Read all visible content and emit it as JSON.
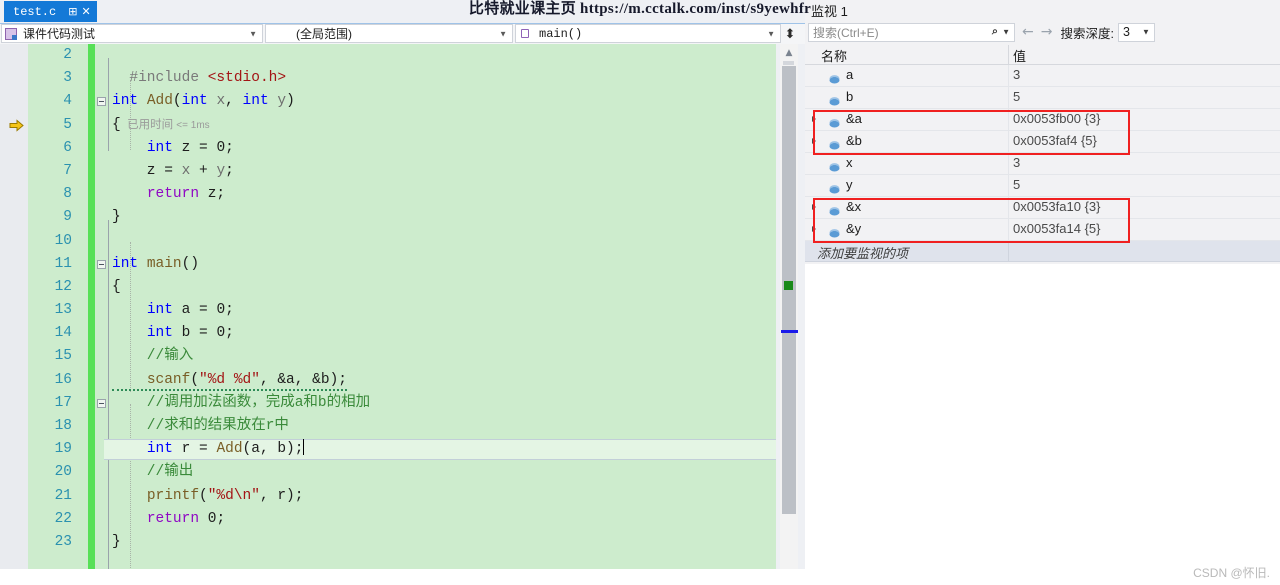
{
  "watermarks": {
    "top": "比特就业课主页  https://m.cctalk.com/inst/s9yewhfr",
    "bottom": "CSDN @怀旧."
  },
  "editor": {
    "tab": {
      "label": "test.c",
      "pin_icon": "pin-icon",
      "close_icon": "close-icon"
    },
    "navbar": {
      "project": "课件代码测试",
      "scope": "(全局范围)",
      "function": "main()",
      "split_icon": "split-view-icon"
    },
    "current_line": 19,
    "exec_pointer_line": 5,
    "inline_diagnostic": {
      "line": 5,
      "text": "已用时间",
      "suffix": "<= 1ms"
    },
    "lines": [
      {
        "n": "2",
        "tokens": []
      },
      {
        "n": "3",
        "tokens": [
          {
            "t": "  ",
            "c": "ident"
          },
          {
            "t": "#include ",
            "c": "pp"
          },
          {
            "t": "<stdio.h>",
            "c": "hdr"
          }
        ]
      },
      {
        "n": "4",
        "collapse": true,
        "tokens": [
          {
            "t": "int",
            "c": "kw"
          },
          {
            "t": " ",
            "c": "ident"
          },
          {
            "t": "Add",
            "c": "fn"
          },
          {
            "t": "(",
            "c": "ident"
          },
          {
            "t": "int",
            "c": "kw"
          },
          {
            "t": " ",
            "c": "ident"
          },
          {
            "t": "x",
            "c": "gray"
          },
          {
            "t": ", ",
            "c": "ident"
          },
          {
            "t": "int",
            "c": "kw"
          },
          {
            "t": " ",
            "c": "ident"
          },
          {
            "t": "y",
            "c": "gray"
          },
          {
            "t": ")",
            "c": "ident"
          }
        ]
      },
      {
        "n": "5",
        "tokens": [
          {
            "t": "{",
            "c": "ident"
          }
        ]
      },
      {
        "n": "6",
        "tokens": [
          {
            "t": "    ",
            "c": "ident"
          },
          {
            "t": "int",
            "c": "kw"
          },
          {
            "t": " z = ",
            "c": "ident"
          },
          {
            "t": "0",
            "c": "ident"
          },
          {
            "t": ";",
            "c": "ident"
          }
        ]
      },
      {
        "n": "7",
        "tokens": [
          {
            "t": "    z = ",
            "c": "ident"
          },
          {
            "t": "x",
            "c": "gray"
          },
          {
            "t": " + ",
            "c": "ident"
          },
          {
            "t": "y",
            "c": "gray"
          },
          {
            "t": ";",
            "c": "ident"
          }
        ]
      },
      {
        "n": "8",
        "tokens": [
          {
            "t": "    ",
            "c": "ident"
          },
          {
            "t": "return",
            "c": "kw2"
          },
          {
            "t": " z;",
            "c": "ident"
          }
        ]
      },
      {
        "n": "9",
        "tokens": [
          {
            "t": "}",
            "c": "ident"
          }
        ]
      },
      {
        "n": "10",
        "tokens": []
      },
      {
        "n": "11",
        "collapse": true,
        "tokens": [
          {
            "t": "int",
            "c": "kw"
          },
          {
            "t": " ",
            "c": "ident"
          },
          {
            "t": "main",
            "c": "fn"
          },
          {
            "t": "()",
            "c": "ident"
          }
        ]
      },
      {
        "n": "12",
        "tokens": [
          {
            "t": "{",
            "c": "ident"
          }
        ]
      },
      {
        "n": "13",
        "tokens": [
          {
            "t": "    ",
            "c": "ident"
          },
          {
            "t": "int",
            "c": "kw"
          },
          {
            "t": " a = ",
            "c": "ident"
          },
          {
            "t": "0",
            "c": "ident"
          },
          {
            "t": ";",
            "c": "ident"
          }
        ]
      },
      {
        "n": "14",
        "tokens": [
          {
            "t": "    ",
            "c": "ident"
          },
          {
            "t": "int",
            "c": "kw"
          },
          {
            "t": " b = ",
            "c": "ident"
          },
          {
            "t": "0",
            "c": "ident"
          },
          {
            "t": ";",
            "c": "ident"
          }
        ]
      },
      {
        "n": "15",
        "tokens": [
          {
            "t": "    //输入",
            "c": "cmt"
          }
        ]
      },
      {
        "n": "16",
        "squiggle": true,
        "tokens": [
          {
            "t": "    ",
            "c": "ident"
          },
          {
            "t": "scanf",
            "c": "fn"
          },
          {
            "t": "(",
            "c": "ident"
          },
          {
            "t": "\"%d %d\"",
            "c": "str"
          },
          {
            "t": ", &a, &b);",
            "c": "ident"
          }
        ]
      },
      {
        "n": "17",
        "collapse": true,
        "tokens": [
          {
            "t": "    //调用加法函数，完成a和b的相加",
            "c": "cmt"
          }
        ]
      },
      {
        "n": "18",
        "tokens": [
          {
            "t": "    //求和的结果放在r中",
            "c": "cmt"
          }
        ]
      },
      {
        "n": "19",
        "caret": true,
        "tokens": [
          {
            "t": "    ",
            "c": "ident"
          },
          {
            "t": "int",
            "c": "kw"
          },
          {
            "t": " r = ",
            "c": "ident"
          },
          {
            "t": "Add",
            "c": "fn"
          },
          {
            "t": "(a, b);",
            "c": "ident"
          }
        ]
      },
      {
        "n": "20",
        "tokens": [
          {
            "t": "    //输出",
            "c": "cmt"
          }
        ]
      },
      {
        "n": "21",
        "tokens": [
          {
            "t": "    ",
            "c": "ident"
          },
          {
            "t": "printf",
            "c": "fn"
          },
          {
            "t": "(",
            "c": "ident"
          },
          {
            "t": "\"%d",
            "c": "str"
          },
          {
            "t": "\\n",
            "c": "hdr"
          },
          {
            "t": "\"",
            "c": "str"
          },
          {
            "t": ", r);",
            "c": "ident"
          }
        ]
      },
      {
        "n": "22",
        "tokens": [
          {
            "t": "    ",
            "c": "ident"
          },
          {
            "t": "return",
            "c": "kw2"
          },
          {
            "t": " ",
            "c": "ident"
          },
          {
            "t": "0",
            "c": "ident"
          },
          {
            "t": ";",
            "c": "ident"
          }
        ]
      },
      {
        "n": "23",
        "tokens": [
          {
            "t": "}",
            "c": "ident"
          }
        ]
      }
    ]
  },
  "watch": {
    "title": "监视 1",
    "search_placeholder": "搜索(Ctrl+E)",
    "search_icon": "search-icon",
    "prev_icon": "arrow-left-icon",
    "next_icon": "arrow-right-icon",
    "depth_label": "搜索深度:",
    "depth_value": "3",
    "columns": {
      "name": "名称",
      "value": "值"
    },
    "rows": [
      {
        "name": "a",
        "value": "3",
        "expandable": false,
        "highlight": false
      },
      {
        "name": "b",
        "value": "5",
        "expandable": false,
        "highlight": false
      },
      {
        "name": "&a",
        "value": "0x0053fb00 {3}",
        "expandable": true,
        "highlight": true
      },
      {
        "name": "&b",
        "value": "0x0053faf4 {5}",
        "expandable": true,
        "highlight": true
      },
      {
        "name": "x",
        "value": "3",
        "expandable": false,
        "highlight": false
      },
      {
        "name": "y",
        "value": "5",
        "expandable": false,
        "highlight": false
      },
      {
        "name": "&x",
        "value": "0x0053fa10 {3}",
        "expandable": true,
        "highlight": true
      },
      {
        "name": "&y",
        "value": "0x0053fa14 {5}",
        "expandable": true,
        "highlight": true
      }
    ],
    "add_placeholder": "添加要监视的项",
    "annotation_color": "#f02020"
  }
}
